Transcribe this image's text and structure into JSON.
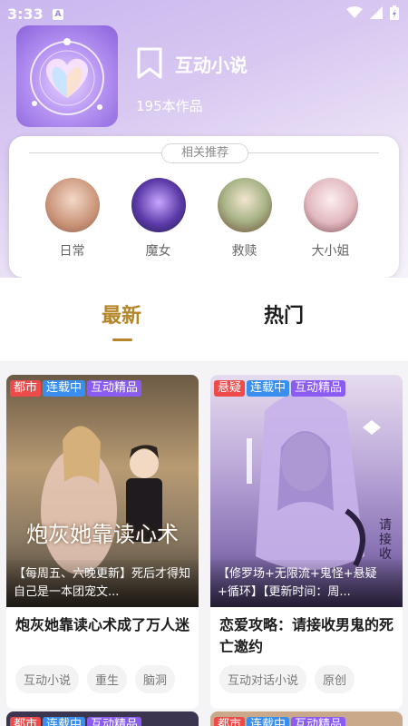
{
  "status_bar": {
    "time": "3:33",
    "notification_letter": "A"
  },
  "topic": {
    "title": "互动小说",
    "work_count": "195本作品"
  },
  "related": {
    "heading": "相关推荐",
    "categories": [
      {
        "label": "日常"
      },
      {
        "label": "魔女"
      },
      {
        "label": "救赎"
      },
      {
        "label": "大小姐"
      }
    ]
  },
  "tabs": [
    {
      "label": "最新",
      "active": true
    },
    {
      "label": "热门",
      "active": false
    }
  ],
  "books": [
    {
      "badges": [
        "都市",
        "连载中",
        "互动精品"
      ],
      "cover_text": "炮灰她靠读心术",
      "blurb": "【每周五、六晚更新】死后才得知自己是一本团宠文...",
      "title": "炮灰她靠读心术成了万人迷",
      "tags": [
        "互动小说",
        "重生",
        "脑洞"
      ]
    },
    {
      "badges": [
        "悬疑",
        "连载中",
        "互动精品"
      ],
      "cover_text": "请接收",
      "blurb": "【修罗场+无限流+鬼怪+悬疑+循环】【更新时间：周...",
      "title": "恋爱攻略：请接收男鬼的死亡邀约",
      "tags": [
        "互动对话小说",
        "原创"
      ]
    }
  ],
  "next_row_badges": [
    [
      "都市",
      "连载中",
      "互动精品"
    ],
    [
      "都市",
      "连载中",
      "互动精品"
    ]
  ],
  "colors": {
    "accent": "#b58528",
    "badge_red": "#ef4a4a",
    "badge_blue": "#3a8ef0",
    "badge_purple": "#8b5cf2"
  }
}
